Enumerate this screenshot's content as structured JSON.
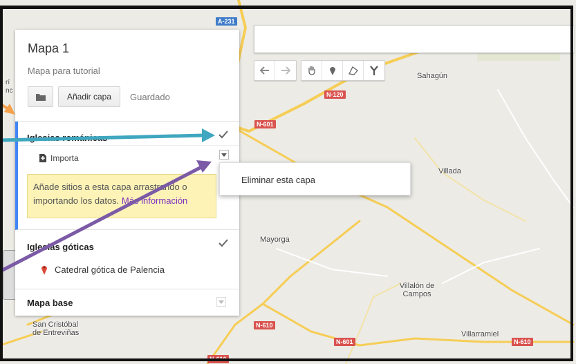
{
  "map": {
    "labels": {
      "sahagun": "Sahagún",
      "villada": "Villada",
      "mayorga": "Mayorga",
      "villalon": "Villalón de\nCampos",
      "villarramiel": "Villarramiel",
      "san_cristobal": "San Cristóbal\nde Entreviñas",
      "cut_left": "rí\nnc"
    },
    "roads": {
      "a231": "A-231",
      "n120": "N-120",
      "n601_a": "N-601",
      "n601_b": "N-601",
      "n610_a": "N-610",
      "n610_b": "N-610",
      "n610_c": "N-610"
    }
  },
  "panel": {
    "title": "Mapa 1",
    "description": "Mapa para tutorial",
    "add_layer_label": "Añadir capa",
    "saved_label": "Guardado",
    "layers": [
      {
        "title": "Iglesias románicas",
        "import_label": "Importa",
        "hint_text": "Añade sitios a esta capa arrastrando o importando los datos.",
        "hint_link": "Más información"
      },
      {
        "title": "Iglesias góticas",
        "place": "Catedral gótica de Palencia"
      }
    ],
    "base_map_label": "Mapa base"
  },
  "context_menu": {
    "delete_layer": "Eliminar esta capa"
  },
  "colors": {
    "accent_layer": "#4285f4",
    "hint_bg": "#fdf3b7",
    "link": "#7b2fbf",
    "arrow_teal": "#3fa7bf",
    "arrow_purple": "#7b5aa6",
    "arrow_orange": "#f5a04a",
    "pin": "#dd4b39"
  },
  "icons": {
    "undo": "undo-icon",
    "redo": "redo-icon",
    "hand": "hand-icon",
    "marker": "marker-icon",
    "line": "draw-line-icon",
    "route": "route-icon",
    "folder": "folder-icon",
    "import": "import-icon"
  }
}
